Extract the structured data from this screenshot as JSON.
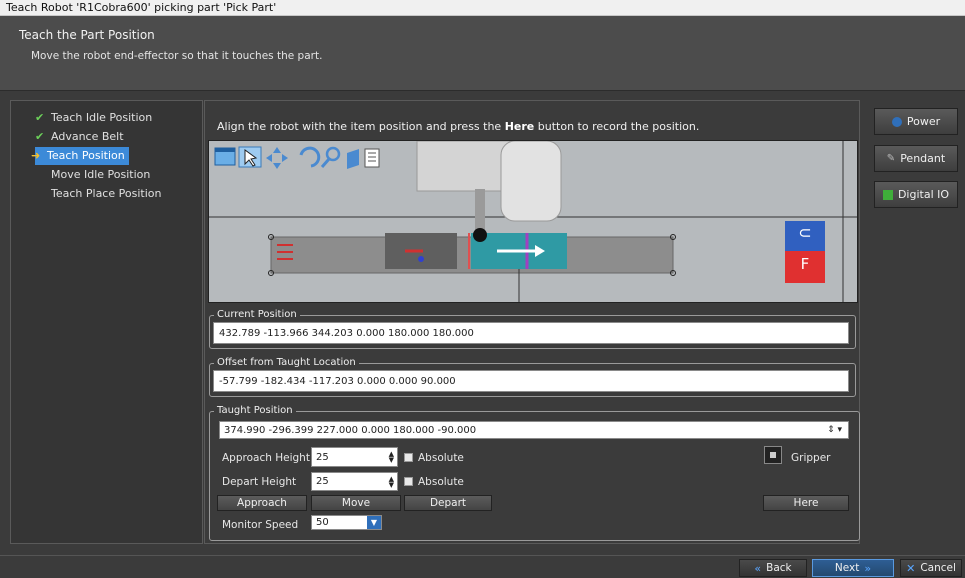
{
  "window": {
    "title": "Teach Robot 'R1Cobra600' picking part 'Pick Part'"
  },
  "header": {
    "title": "Teach the Part Position",
    "subtitle": "Move the robot end-effector so that it touches the part."
  },
  "steps": [
    {
      "label": "Teach Idle Position",
      "state": "done"
    },
    {
      "label": "Advance Belt",
      "state": "done"
    },
    {
      "label": "Teach Position",
      "state": "current"
    },
    {
      "label": "Move Idle Position",
      "state": "pending"
    },
    {
      "label": "Teach Place Position",
      "state": "pending"
    }
  ],
  "instruction": {
    "before": "Align the robot with the item position and press the ",
    "bold": "Here",
    "after": " button to record the position."
  },
  "viewer": {
    "nav_letter_top": "⊂",
    "nav_letter_bottom": "F"
  },
  "current_position": {
    "label": "Current Position",
    "value": "432.789 -113.966 344.203 0.000 180.000 180.000"
  },
  "offset": {
    "label": "Offset from Taught Location",
    "value": "-57.799 -182.434 -117.203 0.000 0.000 90.000"
  },
  "taught": {
    "label": "Taught Position",
    "value": "374.990 -296.399 227.000 0.000 180.000 -90.000",
    "approach_label": "Approach Height",
    "approach_value": "25",
    "depart_label": "Depart Height",
    "depart_value": "25",
    "absolute_label_1": "Absolute",
    "absolute_label_2": "Absolute",
    "gripper_label": "Gripper",
    "approach_btn": "Approach",
    "move_btn": "Move",
    "depart_btn": "Depart",
    "here_btn": "Here",
    "monitor_label": "Monitor Speed",
    "monitor_value": "50"
  },
  "side": {
    "power": "Power",
    "pendant": "Pendant",
    "digital_io": "Digital IO"
  },
  "footer": {
    "back": "Back",
    "next": "Next",
    "cancel": "Cancel"
  },
  "colors": {
    "accent": "#3c8ad8",
    "panel": "#3b3b3b",
    "done": "#6cd05a"
  }
}
